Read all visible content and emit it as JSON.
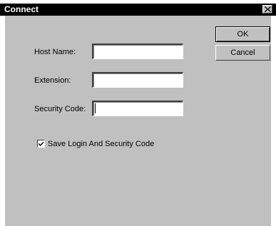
{
  "window": {
    "title": "Connect"
  },
  "form": {
    "host_name_label": "Host Name:",
    "host_name_value": "",
    "extension_label": "Extension:",
    "extension_value": "",
    "security_code_label": "Security Code:",
    "security_code_value": ""
  },
  "buttons": {
    "ok_label": "OK",
    "cancel_label": "Cancel"
  },
  "options": {
    "save_login_label": "Save Login And Security Code",
    "save_login_checked": true
  },
  "icons": {
    "close": "close-icon",
    "check": "checkmark-icon"
  },
  "colors": {
    "titlebar": "#000000",
    "face": "#c0c0c0",
    "field": "#ffffff"
  }
}
